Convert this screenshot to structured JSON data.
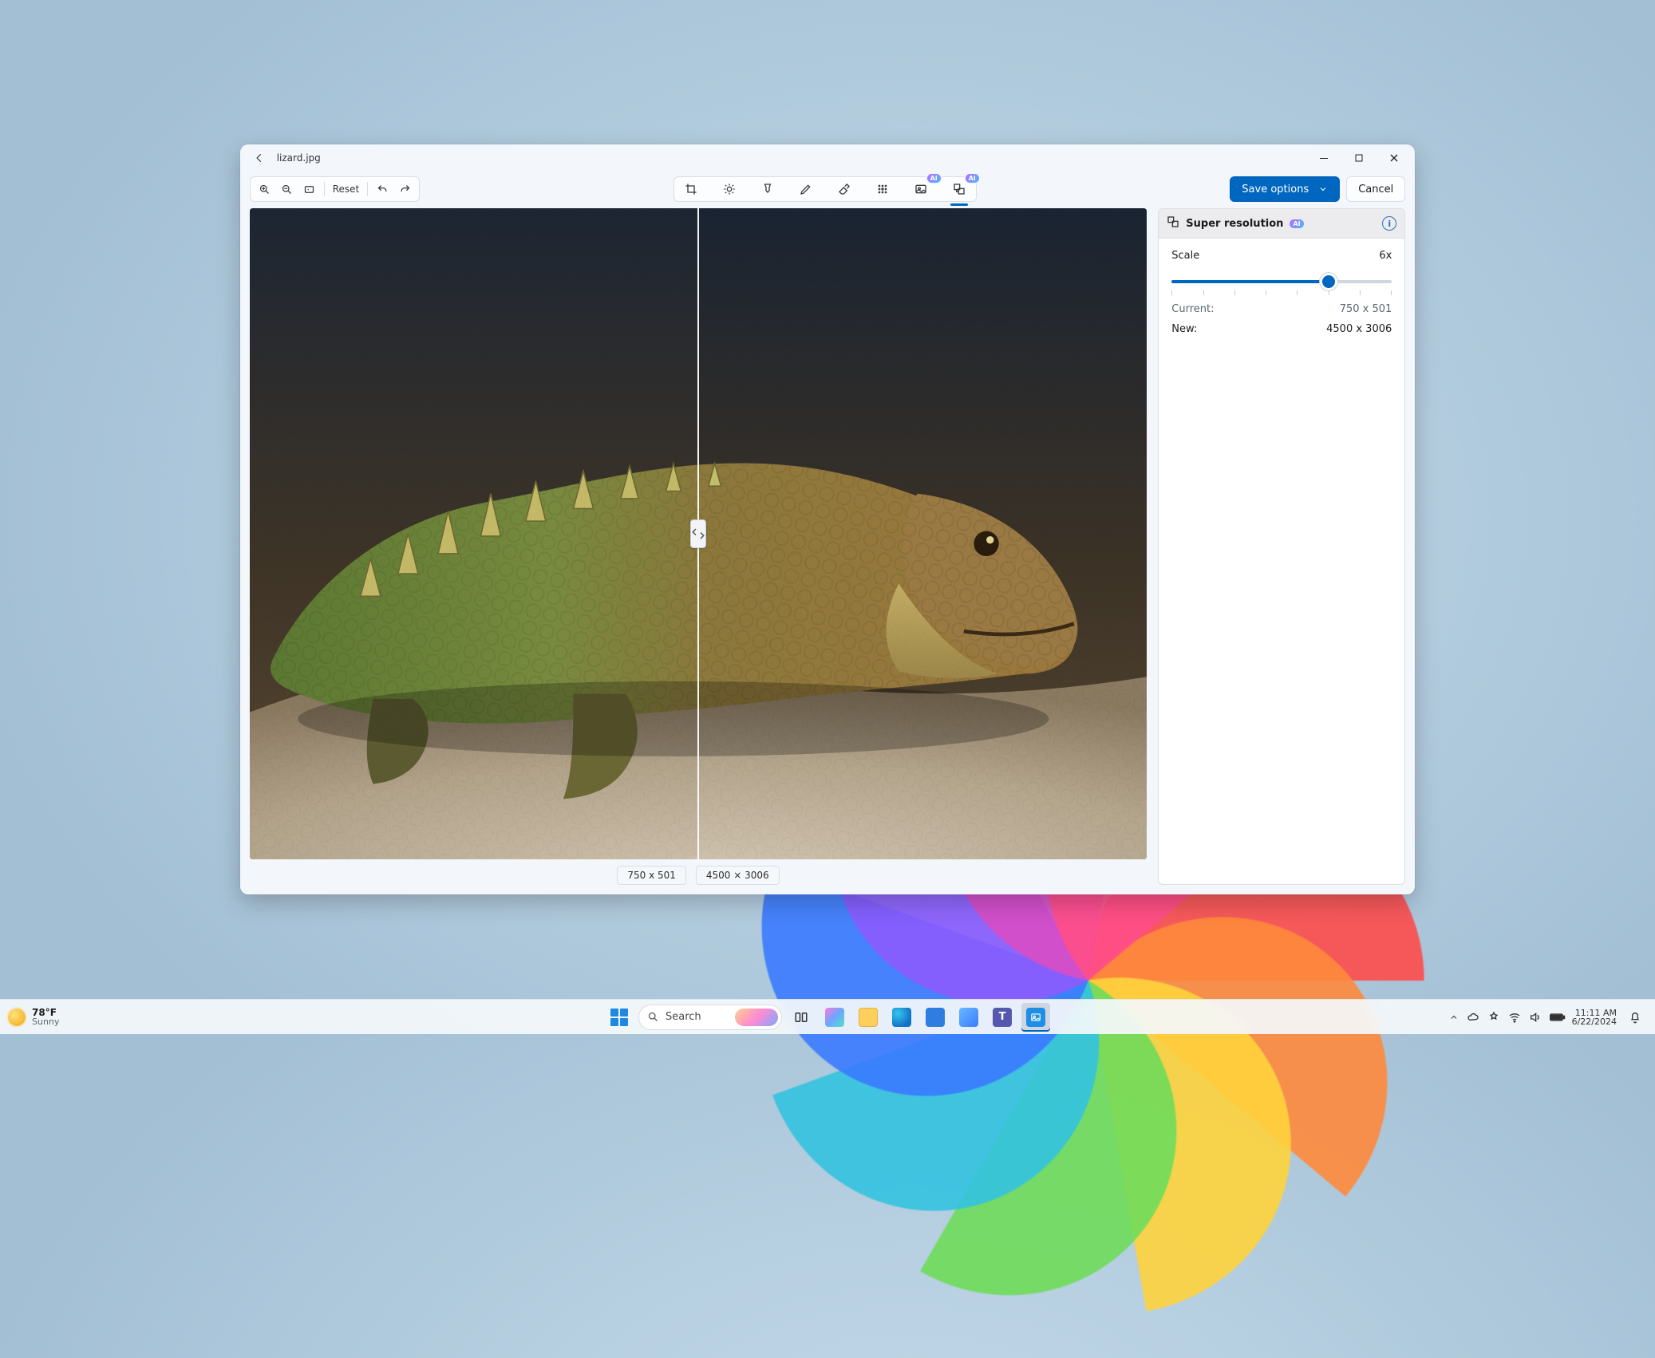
{
  "window": {
    "file_name": "lizard.jpg"
  },
  "toolbar": {
    "reset_label": "Reset",
    "ai_badge": "AI",
    "save_label": "Save options",
    "cancel_label": "Cancel"
  },
  "compare": {
    "left_chip": "750 x 501",
    "right_chip": "4500 × 3006"
  },
  "panel": {
    "title": "Super resolution",
    "ai_badge": "AI",
    "scale_label": "Scale",
    "scale_value": "6x",
    "slider": {
      "min": 1,
      "max": 8,
      "value": 6
    },
    "current_label": "Current:",
    "current_value": "750 x 501",
    "new_label": "New:",
    "new_value": "4500 x 3006"
  },
  "taskbar": {
    "weather": {
      "temp": "78°F",
      "condition": "Sunny"
    },
    "search_placeholder": "Search",
    "clock": {
      "time": "11:11 AM",
      "date": "6/22/2024"
    }
  }
}
